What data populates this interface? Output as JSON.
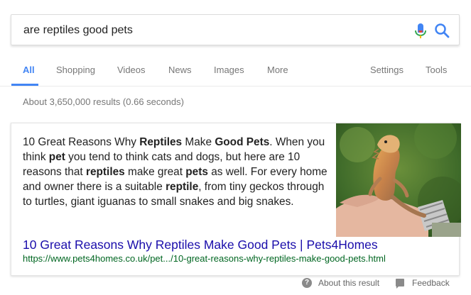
{
  "search": {
    "query": "are reptiles good pets"
  },
  "tabs": [
    {
      "label": "All",
      "active": true
    },
    {
      "label": "Shopping"
    },
    {
      "label": "Videos"
    },
    {
      "label": "News"
    },
    {
      "label": "Images"
    },
    {
      "label": "More"
    },
    {
      "label": "Settings"
    },
    {
      "label": "Tools"
    }
  ],
  "result_stats": "About 3,650,000 results (0.66 seconds)",
  "featured_snippet": {
    "text_segments": [
      {
        "t": "10 Great Reasons Why ",
        "b": false
      },
      {
        "t": "Reptiles",
        "b": true
      },
      {
        "t": " Make ",
        "b": false
      },
      {
        "t": "Good Pets",
        "b": true
      },
      {
        "t": ". When you think ",
        "b": false
      },
      {
        "t": "pet",
        "b": true
      },
      {
        "t": " you tend to think cats and dogs, but here are 10 reasons that ",
        "b": false
      },
      {
        "t": "reptiles",
        "b": true
      },
      {
        "t": " make great ",
        "b": false
      },
      {
        "t": "pets",
        "b": true
      },
      {
        "t": " as well. For every home and owner there is a suitable ",
        "b": false
      },
      {
        "t": "reptile",
        "b": true
      },
      {
        "t": ", from tiny geckos through to turtles, giant iguanas to small snakes and big snakes.",
        "b": false
      }
    ],
    "title": "10 Great Reasons Why Reptiles Make Good Pets | Pets4Homes",
    "url": "https://www.pets4homes.co.uk/pet.../10-great-reasons-why-reptiles-make-good-pets.html",
    "image_icon": "bearded-dragon-photo"
  },
  "footer": {
    "about": "About this result",
    "feedback": "Feedback"
  },
  "colors": {
    "accent": "#4285f4",
    "link": "#1a0dab",
    "url": "#006621"
  }
}
